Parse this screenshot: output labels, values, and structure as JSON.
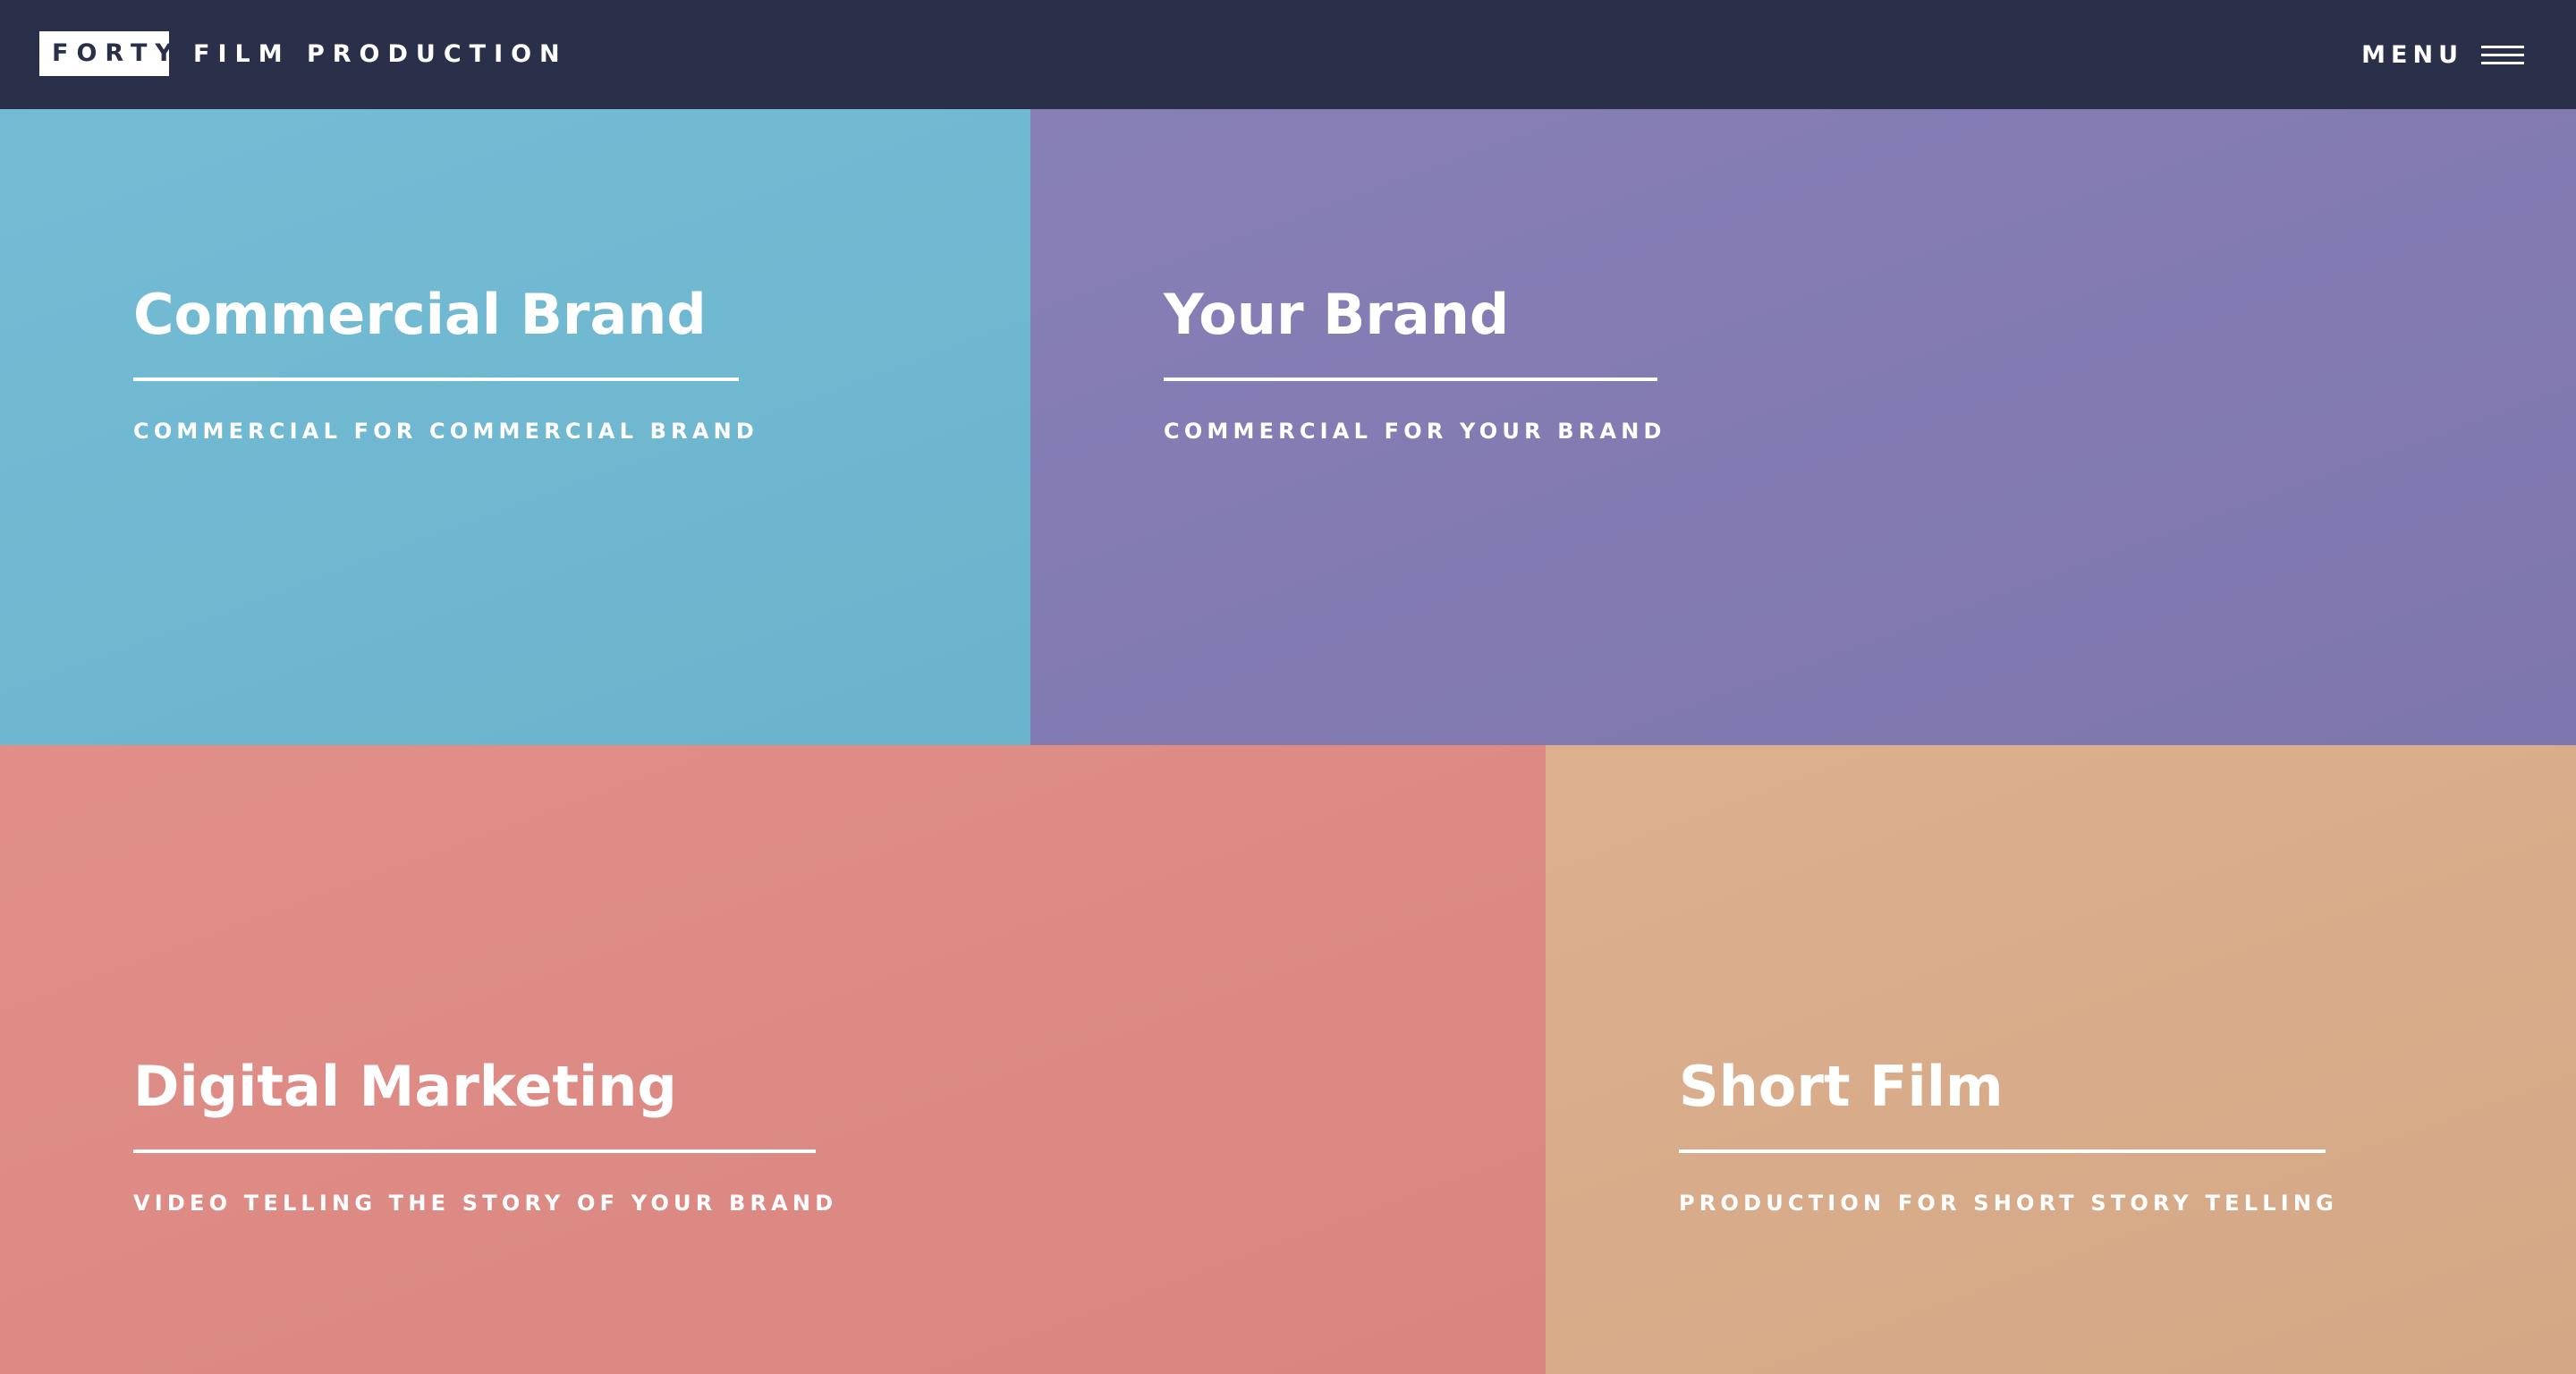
{
  "header": {
    "logo_box": "FORTY",
    "logo_text": "FILM PRODUCTION",
    "menu_label": "MENU"
  },
  "tiles": [
    {
      "title": "Commercial Brand",
      "subtitle": "COMMERCIAL FOR COMMERCIAL BRAND",
      "color": "#6fb9d3"
    },
    {
      "title": "Your Brand",
      "subtitle": "COMMERCIAL FOR YOUR BRAND",
      "color": "#827ab3"
    },
    {
      "title": "Digital Marketing",
      "subtitle": "VIDEO TELLING THE STORY OF YOUR BRAND",
      "color": "#e08a84"
    },
    {
      "title": "Short Film",
      "subtitle": "PRODUCTION FOR SHORT STORY TELLING",
      "color": "#dbad8a"
    }
  ],
  "colors": {
    "header_bg": "#2a2f4a",
    "text": "#ffffff"
  }
}
